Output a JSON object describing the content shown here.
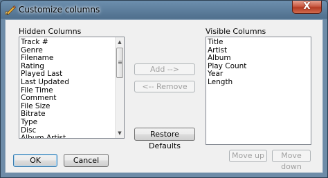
{
  "window": {
    "title": "Customize columns",
    "close_label": "X"
  },
  "hidden_columns": {
    "label": "Hidden Columns",
    "items": [
      "Track #",
      "Genre",
      "Filename",
      "Rating",
      "Played Last",
      "Last Updated",
      "File Time",
      "Comment",
      "File Size",
      "Bitrate",
      "Type",
      "Disc",
      "Album Artist"
    ]
  },
  "visible_columns": {
    "label": "Visible Columns",
    "items": [
      "Title",
      "Artist",
      "Album",
      "Play Count",
      "Year",
      "Length"
    ]
  },
  "buttons": {
    "add": "Add -->",
    "remove": "<-- Remove",
    "restore_defaults": "Restore Defaults",
    "move_up": "Move up",
    "move_down": "Move down",
    "ok": "OK",
    "cancel": "Cancel"
  },
  "icons": {
    "title_icon": "pencil-icon",
    "scroll_up": "scroll-up-arrow-icon",
    "scroll_down": "scroll-down-arrow-icon"
  }
}
